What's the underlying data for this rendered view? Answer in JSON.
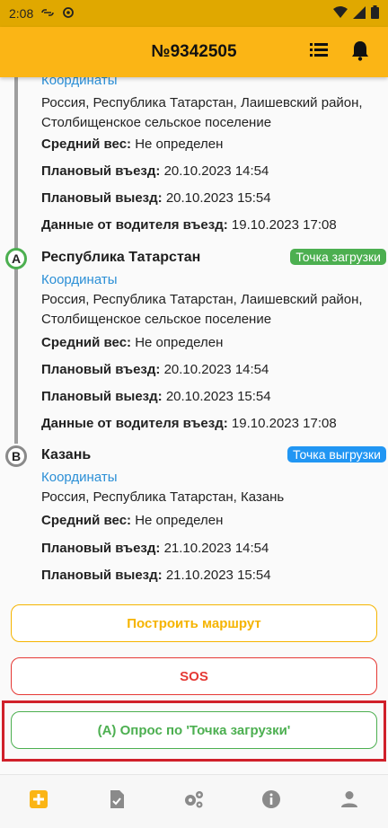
{
  "status_bar": {
    "time": "2:08"
  },
  "header": {
    "title": "№9342505"
  },
  "stops": [
    {
      "coord_link": "Координаты",
      "address": "Россия, Республика Татарстан, Лаишевский район, Столбищенское сельское поселение",
      "weight_label": "Средний вес:",
      "weight_value": "Не определен",
      "arrival_label": "Плановый въезд:",
      "arrival_value": "20.10.2023 14:54",
      "departure_label": "Плановый выезд:",
      "departure_value": "20.10.2023 15:54",
      "driver_label": "Данные от водителя въезд:",
      "driver_value": "19.10.2023 17:08"
    },
    {
      "marker": "A",
      "name": "Республика Татарстан",
      "badge": "Точка загрузки",
      "coord_link": "Координаты",
      "address": "Россия, Республика Татарстан, Лаишевский район, Столбищенское сельское поселение",
      "weight_label": "Средний вес:",
      "weight_value": "Не определен",
      "arrival_label": "Плановый въезд:",
      "arrival_value": "20.10.2023 14:54",
      "departure_label": "Плановый выезд:",
      "departure_value": "20.10.2023 15:54",
      "driver_label": "Данные от водителя въезд:",
      "driver_value": "19.10.2023 17:08"
    },
    {
      "marker": "B",
      "name": "Казань",
      "badge": "Точка выгрузки",
      "coord_link": "Координаты",
      "address": "Россия, Республика Татарстан, Казань",
      "weight_label": "Средний вес:",
      "weight_value": "Не определен",
      "arrival_label": "Плановый въезд:",
      "arrival_value": "21.10.2023 14:54",
      "departure_label": "Плановый выезд:",
      "departure_value": "21.10.2023 15:54"
    }
  ],
  "buttons": {
    "route": "Построить маршрут",
    "sos": "SOS",
    "survey": "(A) Опрос по 'Точка загрузки'"
  },
  "colors": {
    "accent": "#fbb515",
    "load_badge": "#4caf50",
    "unload_badge": "#2196f3",
    "link": "#2b8fd6",
    "sos": "#e53935",
    "highlight": "#d0202a"
  },
  "bottom_nav": [
    "add-box-icon",
    "task-check-icon",
    "settings-icon",
    "info-icon",
    "person-icon"
  ]
}
